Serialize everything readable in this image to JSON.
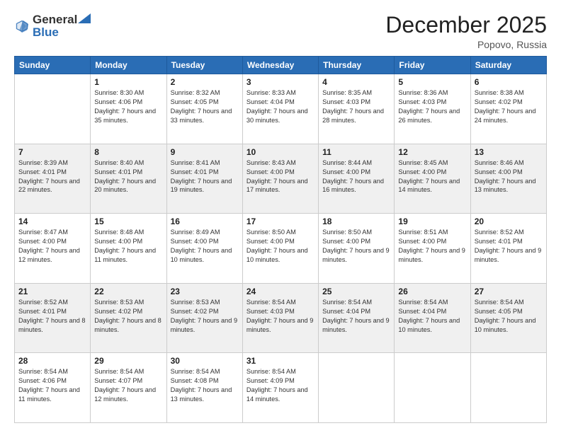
{
  "header": {
    "logo_general": "General",
    "logo_blue": "Blue",
    "month_title": "December 2025",
    "location": "Popovo, Russia"
  },
  "days_of_week": [
    "Sunday",
    "Monday",
    "Tuesday",
    "Wednesday",
    "Thursday",
    "Friday",
    "Saturday"
  ],
  "weeks": [
    [
      {
        "day": "",
        "sunrise": "",
        "sunset": "",
        "daylight": ""
      },
      {
        "day": "1",
        "sunrise": "Sunrise: 8:30 AM",
        "sunset": "Sunset: 4:06 PM",
        "daylight": "Daylight: 7 hours and 35 minutes."
      },
      {
        "day": "2",
        "sunrise": "Sunrise: 8:32 AM",
        "sunset": "Sunset: 4:05 PM",
        "daylight": "Daylight: 7 hours and 33 minutes."
      },
      {
        "day": "3",
        "sunrise": "Sunrise: 8:33 AM",
        "sunset": "Sunset: 4:04 PM",
        "daylight": "Daylight: 7 hours and 30 minutes."
      },
      {
        "day": "4",
        "sunrise": "Sunrise: 8:35 AM",
        "sunset": "Sunset: 4:03 PM",
        "daylight": "Daylight: 7 hours and 28 minutes."
      },
      {
        "day": "5",
        "sunrise": "Sunrise: 8:36 AM",
        "sunset": "Sunset: 4:03 PM",
        "daylight": "Daylight: 7 hours and 26 minutes."
      },
      {
        "day": "6",
        "sunrise": "Sunrise: 8:38 AM",
        "sunset": "Sunset: 4:02 PM",
        "daylight": "Daylight: 7 hours and 24 minutes."
      }
    ],
    [
      {
        "day": "7",
        "sunrise": "Sunrise: 8:39 AM",
        "sunset": "Sunset: 4:01 PM",
        "daylight": "Daylight: 7 hours and 22 minutes."
      },
      {
        "day": "8",
        "sunrise": "Sunrise: 8:40 AM",
        "sunset": "Sunset: 4:01 PM",
        "daylight": "Daylight: 7 hours and 20 minutes."
      },
      {
        "day": "9",
        "sunrise": "Sunrise: 8:41 AM",
        "sunset": "Sunset: 4:01 PM",
        "daylight": "Daylight: 7 hours and 19 minutes."
      },
      {
        "day": "10",
        "sunrise": "Sunrise: 8:43 AM",
        "sunset": "Sunset: 4:00 PM",
        "daylight": "Daylight: 7 hours and 17 minutes."
      },
      {
        "day": "11",
        "sunrise": "Sunrise: 8:44 AM",
        "sunset": "Sunset: 4:00 PM",
        "daylight": "Daylight: 7 hours and 16 minutes."
      },
      {
        "day": "12",
        "sunrise": "Sunrise: 8:45 AM",
        "sunset": "Sunset: 4:00 PM",
        "daylight": "Daylight: 7 hours and 14 minutes."
      },
      {
        "day": "13",
        "sunrise": "Sunrise: 8:46 AM",
        "sunset": "Sunset: 4:00 PM",
        "daylight": "Daylight: 7 hours and 13 minutes."
      }
    ],
    [
      {
        "day": "14",
        "sunrise": "Sunrise: 8:47 AM",
        "sunset": "Sunset: 4:00 PM",
        "daylight": "Daylight: 7 hours and 12 minutes."
      },
      {
        "day": "15",
        "sunrise": "Sunrise: 8:48 AM",
        "sunset": "Sunset: 4:00 PM",
        "daylight": "Daylight: 7 hours and 11 minutes."
      },
      {
        "day": "16",
        "sunrise": "Sunrise: 8:49 AM",
        "sunset": "Sunset: 4:00 PM",
        "daylight": "Daylight: 7 hours and 10 minutes."
      },
      {
        "day": "17",
        "sunrise": "Sunrise: 8:50 AM",
        "sunset": "Sunset: 4:00 PM",
        "daylight": "Daylight: 7 hours and 10 minutes."
      },
      {
        "day": "18",
        "sunrise": "Sunrise: 8:50 AM",
        "sunset": "Sunset: 4:00 PM",
        "daylight": "Daylight: 7 hours and 9 minutes."
      },
      {
        "day": "19",
        "sunrise": "Sunrise: 8:51 AM",
        "sunset": "Sunset: 4:00 PM",
        "daylight": "Daylight: 7 hours and 9 minutes."
      },
      {
        "day": "20",
        "sunrise": "Sunrise: 8:52 AM",
        "sunset": "Sunset: 4:01 PM",
        "daylight": "Daylight: 7 hours and 9 minutes."
      }
    ],
    [
      {
        "day": "21",
        "sunrise": "Sunrise: 8:52 AM",
        "sunset": "Sunset: 4:01 PM",
        "daylight": "Daylight: 7 hours and 8 minutes."
      },
      {
        "day": "22",
        "sunrise": "Sunrise: 8:53 AM",
        "sunset": "Sunset: 4:02 PM",
        "daylight": "Daylight: 7 hours and 8 minutes."
      },
      {
        "day": "23",
        "sunrise": "Sunrise: 8:53 AM",
        "sunset": "Sunset: 4:02 PM",
        "daylight": "Daylight: 7 hours and 9 minutes."
      },
      {
        "day": "24",
        "sunrise": "Sunrise: 8:54 AM",
        "sunset": "Sunset: 4:03 PM",
        "daylight": "Daylight: 7 hours and 9 minutes."
      },
      {
        "day": "25",
        "sunrise": "Sunrise: 8:54 AM",
        "sunset": "Sunset: 4:04 PM",
        "daylight": "Daylight: 7 hours and 9 minutes."
      },
      {
        "day": "26",
        "sunrise": "Sunrise: 8:54 AM",
        "sunset": "Sunset: 4:04 PM",
        "daylight": "Daylight: 7 hours and 10 minutes."
      },
      {
        "day": "27",
        "sunrise": "Sunrise: 8:54 AM",
        "sunset": "Sunset: 4:05 PM",
        "daylight": "Daylight: 7 hours and 10 minutes."
      }
    ],
    [
      {
        "day": "28",
        "sunrise": "Sunrise: 8:54 AM",
        "sunset": "Sunset: 4:06 PM",
        "daylight": "Daylight: 7 hours and 11 minutes."
      },
      {
        "day": "29",
        "sunrise": "Sunrise: 8:54 AM",
        "sunset": "Sunset: 4:07 PM",
        "daylight": "Daylight: 7 hours and 12 minutes."
      },
      {
        "day": "30",
        "sunrise": "Sunrise: 8:54 AM",
        "sunset": "Sunset: 4:08 PM",
        "daylight": "Daylight: 7 hours and 13 minutes."
      },
      {
        "day": "31",
        "sunrise": "Sunrise: 8:54 AM",
        "sunset": "Sunset: 4:09 PM",
        "daylight": "Daylight: 7 hours and 14 minutes."
      },
      {
        "day": "",
        "sunrise": "",
        "sunset": "",
        "daylight": ""
      },
      {
        "day": "",
        "sunrise": "",
        "sunset": "",
        "daylight": ""
      },
      {
        "day": "",
        "sunrise": "",
        "sunset": "",
        "daylight": ""
      }
    ]
  ]
}
